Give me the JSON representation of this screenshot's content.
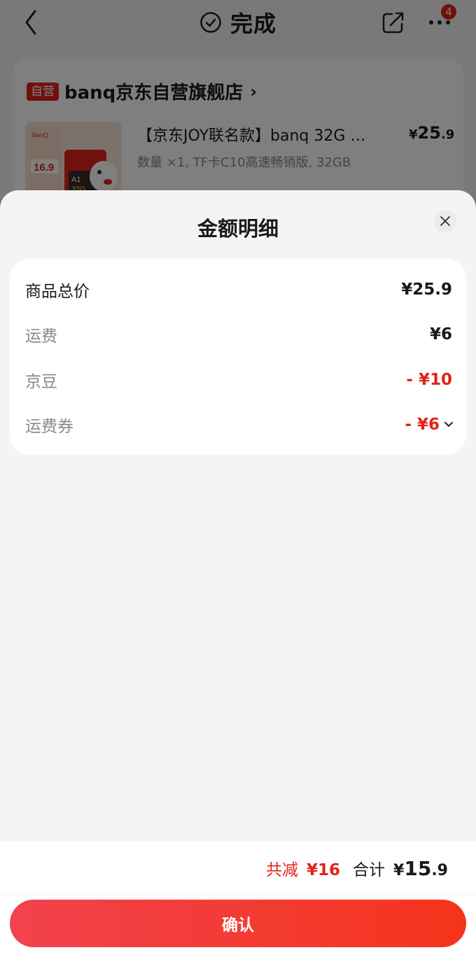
{
  "header": {
    "title": "完成",
    "more_badge": "4"
  },
  "store": {
    "tag": "自营",
    "name": "banq京东自营旗舰店",
    "chevron": "›"
  },
  "product": {
    "title": "【京东JOY联名款】banq 32G …",
    "price_symbol": "¥",
    "price_int": "25",
    "price_dec": ".9",
    "spec": "数量 ×1, TF卡C10高速畅销版, 32GB",
    "thumb_texts": [
      "BanQ",
      "16.9",
      "A1",
      "32G"
    ]
  },
  "sheet": {
    "title": "金额明细",
    "rows": [
      {
        "label": "商品总价",
        "value": "¥25.9"
      },
      {
        "label": "运费",
        "value": "¥6"
      },
      {
        "label": "京豆",
        "value": "- ¥10"
      },
      {
        "label": "运费券",
        "value": "- ¥6"
      }
    ]
  },
  "footer": {
    "reduce_label": "共减",
    "reduce_value": "¥16",
    "total_label": "合计",
    "total_symbol": "¥",
    "total_int": "15",
    "total_dec": ".9",
    "confirm_label": "确认"
  },
  "colors": {
    "accent_red": "#e2231a",
    "button_gradient_start": "#f2424e",
    "button_gradient_end": "#f5331b"
  }
}
